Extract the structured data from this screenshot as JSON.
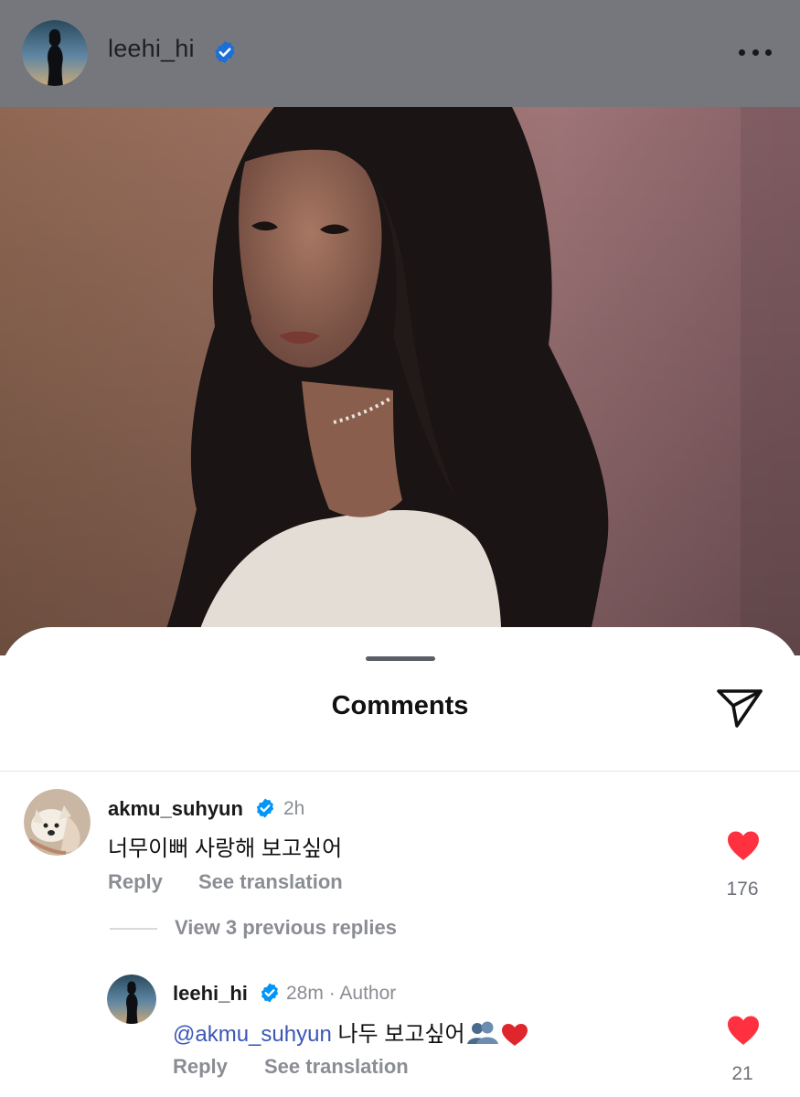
{
  "header": {
    "username": "leehi_hi",
    "verified": true
  },
  "sheet": {
    "title": "Comments"
  },
  "comments": [
    {
      "username": "akmu_suhyun",
      "verified": true,
      "time": "2h",
      "text": "너무이뻐 사랑해 보고싶어",
      "reply_label": "Reply",
      "translate_label": "See translation",
      "likes": "176",
      "liked": true
    }
  ],
  "view_replies_label": "View 3 previous replies",
  "replies": [
    {
      "username": "leehi_hi",
      "verified": true,
      "time": "28m",
      "author_label": "Author",
      "separator": "·",
      "mention": "@akmu_suhyun",
      "text": " 나두 보고싶어",
      "emojis": "👥❤️",
      "reply_label": "Reply",
      "translate_label": "See translation",
      "likes": "21",
      "liked": true
    }
  ],
  "colors": {
    "header_bg": "#75777c",
    "verified_blue": "#0095f6",
    "like_red": "#ff3040",
    "mention_blue": "#3b56b8",
    "secondary_text": "#8a8d93"
  },
  "icons": {
    "more": "more-horizontal-icon",
    "share": "paper-plane-icon",
    "verified": "verified-badge-icon",
    "like": "heart-icon"
  }
}
